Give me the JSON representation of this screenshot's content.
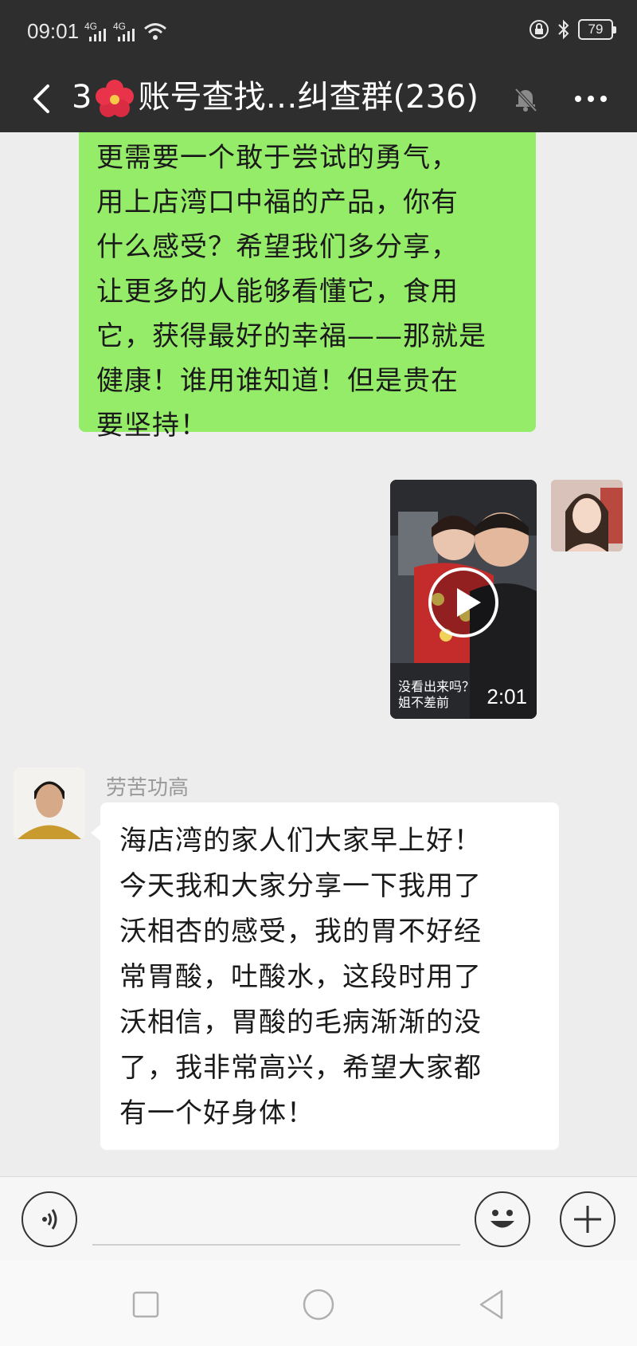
{
  "status_bar": {
    "time": "09:01",
    "signal1": "4G",
    "signal2": "4G",
    "battery": "79"
  },
  "header": {
    "title_prefix": "3",
    "title_main": "账号查找…纠查群(236)"
  },
  "messages": {
    "outgoing_text_lines": [
      "更需要一个敢于尝试的勇气，",
      "用上店湾口中福的产品，你有",
      "什么感受？希望我们多分享，",
      "让更多的人能够看懂它，食用",
      "它，获得最好的幸福——那就是",
      "健康！谁用谁知道！但是贵在",
      "要坚持！"
    ],
    "video": {
      "caption": "没看出来吗？姐不差前",
      "duration": "2:01"
    },
    "incoming": {
      "sender": "劳苦功高",
      "text_lines": [
        "海店湾的家人们大家早上好！",
        "今天我和大家分享一下我用了",
        "沃相杏的感受，我的胃不好经",
        "常胃酸，吐酸水，这段时用了",
        "沃相信，胃酸的毛病渐渐的没",
        "了，我非常高兴，希望大家都",
        "有一个好身体！"
      ]
    }
  },
  "colors": {
    "header_bg": "#2e2e2e",
    "outgoing_bubble": "#95ec69",
    "incoming_bubble": "#ffffff",
    "chat_bg": "#ededed"
  },
  "icons": {
    "back": "chevron-left-icon",
    "flower": "hibiscus-icon",
    "mute": "bell-muted-icon",
    "more": "more-dots-icon",
    "voice": "voice-icon",
    "emoji": "emoji-icon",
    "plus": "plus-icon",
    "nav_recent": "square-icon",
    "nav_home": "circle-icon",
    "nav_back": "triangle-back-icon"
  }
}
